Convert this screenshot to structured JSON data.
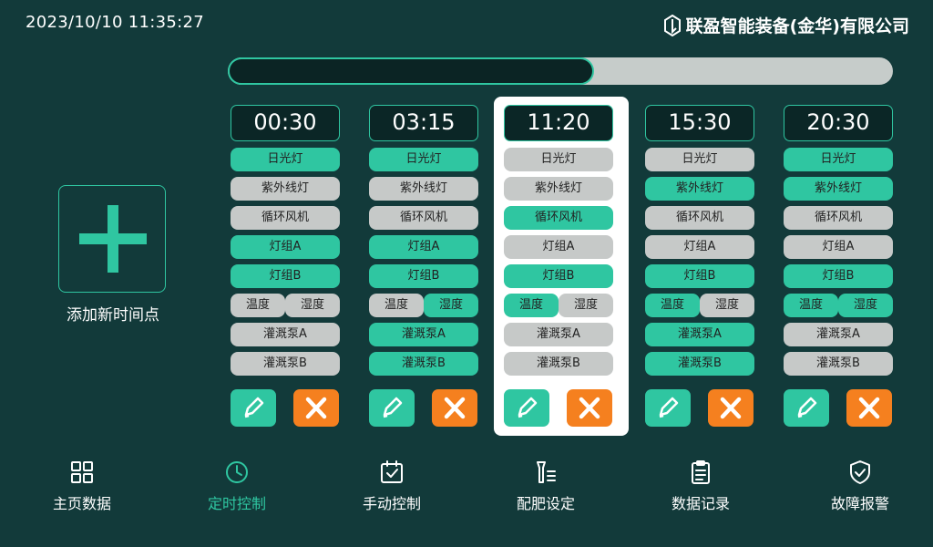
{
  "header": {
    "datetime": "2023/10/10  11:35:27",
    "brand": "联盈智能装备(金华)有限公司",
    "brand_icon": "hexagon-logo-icon"
  },
  "progress": {
    "fraction": 0.55
  },
  "add_point": {
    "label": "添加新时间点",
    "icon": "plus-icon"
  },
  "colors": {
    "background": "#123a3a",
    "accent": "#2fc6a1",
    "off": "#c6c9c8",
    "delete": "#f5801f",
    "selected_card": "#ffffff"
  },
  "schedules": [
    {
      "time": "00:30",
      "selected": false,
      "lamp": {
        "label": "日光灯",
        "on": true
      },
      "uv": {
        "label": "紫外线灯",
        "on": false
      },
      "fan": {
        "label": "循环风机",
        "on": false
      },
      "groupA": {
        "label": "灯组A",
        "on": true
      },
      "groupB": {
        "label": "灯组B",
        "on": true
      },
      "temp": {
        "label": "温度",
        "on": false
      },
      "humid": {
        "label": "湿度",
        "on": false
      },
      "pumpA": {
        "label": "灌溉泵A",
        "on": false
      },
      "pumpB": {
        "label": "灌溉泵B",
        "on": false
      }
    },
    {
      "time": "03:15",
      "selected": false,
      "lamp": {
        "label": "日光灯",
        "on": true
      },
      "uv": {
        "label": "紫外线灯",
        "on": false
      },
      "fan": {
        "label": "循环风机",
        "on": false
      },
      "groupA": {
        "label": "灯组A",
        "on": true
      },
      "groupB": {
        "label": "灯组B",
        "on": true
      },
      "temp": {
        "label": "温度",
        "on": false
      },
      "humid": {
        "label": "湿度",
        "on": true
      },
      "pumpA": {
        "label": "灌溉泵A",
        "on": true
      },
      "pumpB": {
        "label": "灌溉泵B",
        "on": true
      }
    },
    {
      "time": "11:20",
      "selected": true,
      "lamp": {
        "label": "日光灯",
        "on": false
      },
      "uv": {
        "label": "紫外线灯",
        "on": false
      },
      "fan": {
        "label": "循环风机",
        "on": true
      },
      "groupA": {
        "label": "灯组A",
        "on": false
      },
      "groupB": {
        "label": "灯组B",
        "on": true
      },
      "temp": {
        "label": "温度",
        "on": true
      },
      "humid": {
        "label": "湿度",
        "on": false
      },
      "pumpA": {
        "label": "灌溉泵A",
        "on": false
      },
      "pumpB": {
        "label": "灌溉泵B",
        "on": false
      }
    },
    {
      "time": "15:30",
      "selected": false,
      "lamp": {
        "label": "日光灯",
        "on": false
      },
      "uv": {
        "label": "紫外线灯",
        "on": true
      },
      "fan": {
        "label": "循环风机",
        "on": false
      },
      "groupA": {
        "label": "灯组A",
        "on": false
      },
      "groupB": {
        "label": "灯组B",
        "on": true
      },
      "temp": {
        "label": "温度",
        "on": true
      },
      "humid": {
        "label": "湿度",
        "on": false
      },
      "pumpA": {
        "label": "灌溉泵A",
        "on": true
      },
      "pumpB": {
        "label": "灌溉泵B",
        "on": true
      }
    },
    {
      "time": "20:30",
      "selected": false,
      "lamp": {
        "label": "日光灯",
        "on": true
      },
      "uv": {
        "label": "紫外线灯",
        "on": true
      },
      "fan": {
        "label": "循环风机",
        "on": false
      },
      "groupA": {
        "label": "灯组A",
        "on": false
      },
      "groupB": {
        "label": "灯组B",
        "on": true
      },
      "temp": {
        "label": "温度",
        "on": true
      },
      "humid": {
        "label": "湿度",
        "on": true
      },
      "pumpA": {
        "label": "灌溉泵A",
        "on": false
      },
      "pumpB": {
        "label": "灌溉泵B",
        "on": false
      }
    }
  ],
  "card_actions": {
    "edit_icon": "pencil-icon",
    "delete_icon": "close-icon"
  },
  "nav": [
    {
      "label": "主页数据",
      "icon": "grid-icon",
      "active": false
    },
    {
      "label": "定时控制",
      "icon": "clock-icon",
      "active": true
    },
    {
      "label": "手动控制",
      "icon": "calendar-check-icon",
      "active": false
    },
    {
      "label": "配肥设定",
      "icon": "fertilizer-icon",
      "active": false
    },
    {
      "label": "数据记录",
      "icon": "clipboard-icon",
      "active": false
    },
    {
      "label": "故障报警",
      "icon": "shield-check-icon",
      "active": false
    }
  ]
}
